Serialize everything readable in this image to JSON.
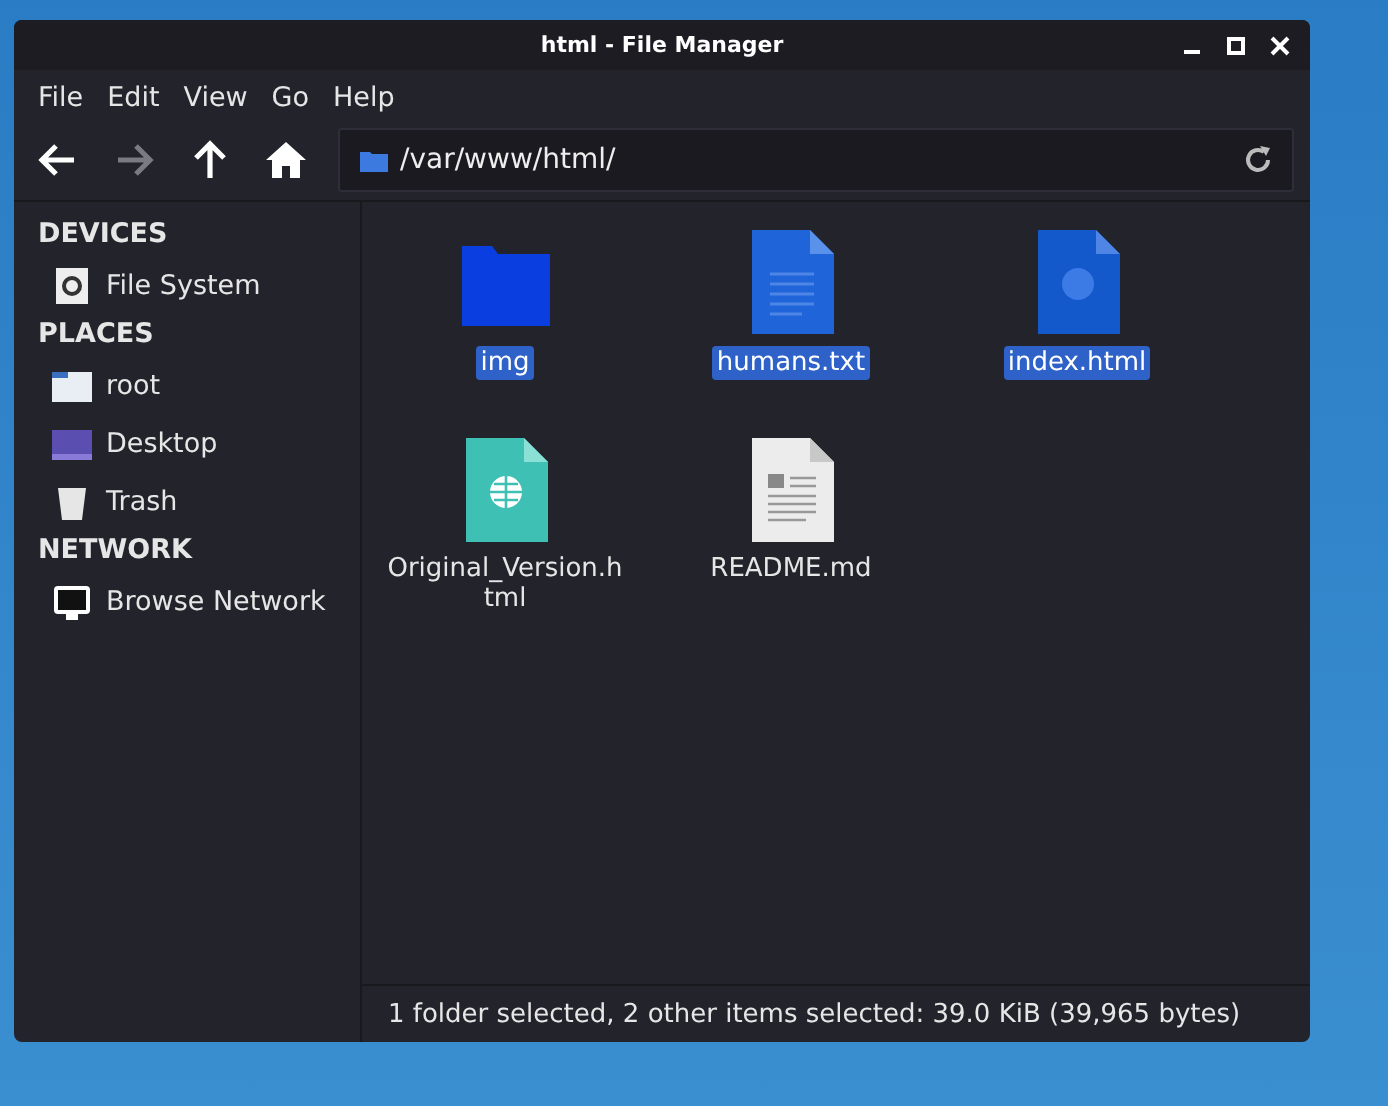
{
  "window": {
    "title": "html - File Manager"
  },
  "menu": [
    "File",
    "Edit",
    "View",
    "Go",
    "Help"
  ],
  "toolbar": [
    {
      "kind": "back",
      "disabled": false
    },
    {
      "kind": "forward",
      "disabled": true
    },
    {
      "kind": "up",
      "disabled": false
    },
    {
      "kind": "home",
      "disabled": false
    }
  ],
  "location": {
    "value": "/var/www/html/"
  },
  "sidebar": [
    {
      "heading": "DEVICES",
      "items": [
        {
          "label": "File System",
          "kind": "drive"
        }
      ]
    },
    {
      "heading": "PLACES",
      "items": [
        {
          "label": "root",
          "kind": "home"
        },
        {
          "label": "Desktop",
          "kind": "desktop"
        },
        {
          "label": "Trash",
          "kind": "trash"
        }
      ]
    },
    {
      "heading": "NETWORK",
      "items": [
        {
          "label": "Browse Network",
          "kind": "network"
        }
      ]
    }
  ],
  "files": [
    {
      "name": "img",
      "kind": "folder",
      "selected": true
    },
    {
      "name": "humans.txt",
      "kind": "text",
      "selected": true
    },
    {
      "name": "index.html",
      "kind": "html",
      "selected": true
    },
    {
      "name": "Original_Version.h tml",
      "kind": "web",
      "selected": false
    },
    {
      "name": "README.md",
      "kind": "document",
      "selected": false
    }
  ],
  "status_bar": "1 folder selected, 2 other items selected: 39.0 KiB (39,965 bytes)"
}
